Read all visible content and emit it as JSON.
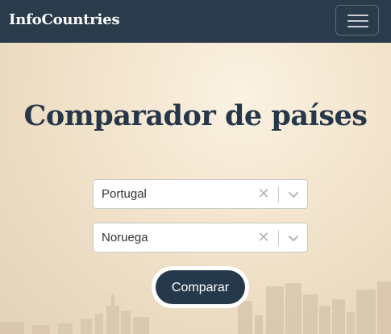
{
  "navbar": {
    "brand": "InfoCountries",
    "menu_icon": "hamburger-menu-icon"
  },
  "main": {
    "title": "Comparador de países",
    "country_1": {
      "value": "Portugal",
      "clear_icon": "close-icon",
      "dropdown_icon": "chevron-down-icon"
    },
    "country_2": {
      "value": "Noruega",
      "clear_icon": "close-icon",
      "dropdown_icon": "chevron-down-icon"
    },
    "compare_label": "Comparar"
  },
  "colors": {
    "navbar_bg": "#2a3b4b",
    "title": "#27374a",
    "button_bg": "#26394b"
  }
}
